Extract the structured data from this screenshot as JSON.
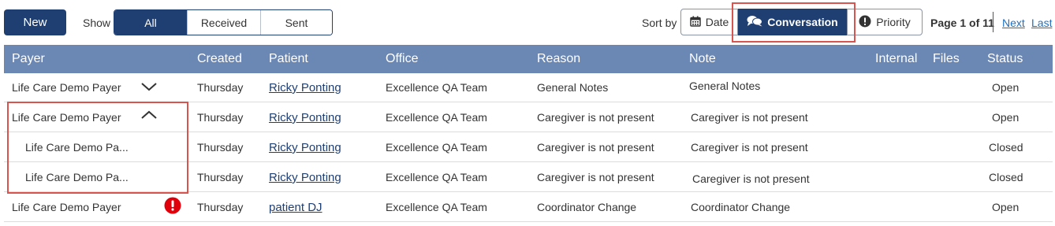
{
  "toolbar": {
    "new_label": "New",
    "show_label": "Show",
    "filters": [
      "All",
      "Received",
      "Sent"
    ],
    "active_filter": "All",
    "sort_label": "Sort by",
    "sort_options": [
      {
        "label": "Date",
        "icon": "calendar-icon"
      },
      {
        "label": "Conversation",
        "icon": "conversation-icon"
      },
      {
        "label": "Priority",
        "icon": "exclamation-icon"
      }
    ],
    "active_sort": "Conversation",
    "page_info": "Page 1 of 11",
    "next_label": "Next",
    "last_label": "Last"
  },
  "table": {
    "columns": [
      "Payer",
      "Created",
      "Patient",
      "Office",
      "Reason",
      "Note",
      "Internal",
      "Files",
      "Status"
    ],
    "rows": [
      {
        "payer": "Life Care Demo Payer",
        "created": "Thursday",
        "patient": "Ricky Ponting",
        "office": "Excellence QA Team",
        "reason": "General Notes",
        "note": "General Notes",
        "internal": "",
        "files": "",
        "status": "Open",
        "chevron": "down"
      },
      {
        "payer": "Life Care Demo Payer",
        "created": "Thursday",
        "patient": "Ricky Ponting",
        "office": "Excellence QA Team",
        "reason": "Caregiver is not present",
        "note": "Caregiver is not present",
        "internal": "",
        "files": "",
        "status": "Open",
        "chevron": "up"
      },
      {
        "payer": "Life Care Demo Pa...",
        "created": "Thursday",
        "patient": "Ricky Ponting",
        "office": "Excellence QA Team",
        "reason": "Caregiver is not present",
        "note": "Caregiver is not present",
        "internal": "",
        "files": "",
        "status": "Closed"
      },
      {
        "payer": "Life Care Demo Pa...",
        "created": "Thursday",
        "patient": "Ricky Ponting",
        "office": "Excellence QA Team",
        "reason": "Caregiver is not present",
        "note": "Caregiver is not present",
        "internal": "",
        "files": "",
        "status": "Closed"
      },
      {
        "payer": "Life Care Demo Payer",
        "created": "Thursday",
        "patient": "patient DJ",
        "office": "Excellence QA Team",
        "reason": "Coordinator Change",
        "note": "Coordinator Change",
        "internal": "",
        "files": "",
        "status": "Open",
        "alert": true
      }
    ]
  },
  "colors": {
    "primary": "#1f3f73",
    "header_bg": "#6b87b4",
    "highlight": "#d9534f",
    "alert": "#e0000b",
    "link": "#1f6fc0"
  }
}
